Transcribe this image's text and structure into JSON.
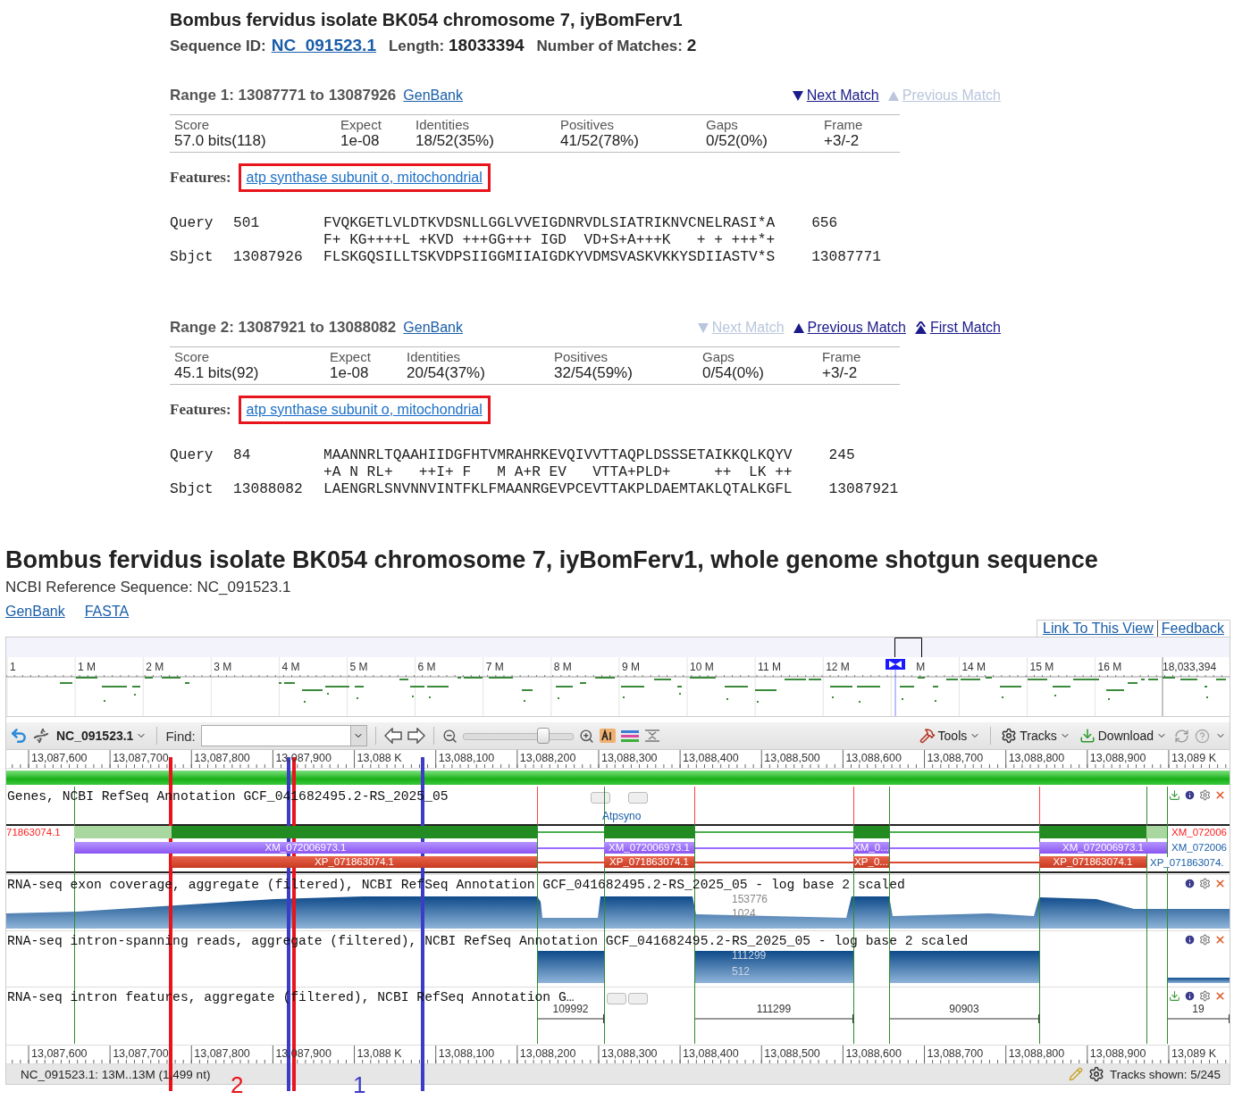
{
  "blast": {
    "title": "Bombus fervidus isolate BK054 chromosome 7, iyBomFerv1",
    "sequence_id_label": "Sequence ID:",
    "sequence_id": "NC_091523.1",
    "length_label": "Length:",
    "length": "18033394",
    "matches_label": "Number of Matches:",
    "matches": "2",
    "ranges": [
      {
        "title": "Range 1: 13087771 to 13087926",
        "genbank": "GenBank",
        "nav": [
          {
            "kind": "next",
            "label": "Next Match",
            "disabled": false
          },
          {
            "kind": "previous",
            "label": "Previous Match",
            "disabled": true
          }
        ],
        "stats": [
          {
            "label": "Score",
            "value": "57.0 bits(118)"
          },
          {
            "label": "Expect",
            "value": "1e-08"
          },
          {
            "label": "Identities",
            "value": "18/52(35%)"
          },
          {
            "label": "Positives",
            "value": "41/52(78%)"
          },
          {
            "label": "Gaps",
            "value": "0/52(0%)"
          },
          {
            "label": "Frame",
            "value": "+3/-2"
          }
        ],
        "features_label": "Features:",
        "feature": "atp synthase subunit o, mitochondrial",
        "query": {
          "label": "Query",
          "start": "501",
          "sequence": "FVQKGETLVLDTKVDSNLLGGLVVEIGDNRVDLSIATRIKNVCNELRASI*A",
          "end": "656"
        },
        "midline": "F+ KG++++L +KVD +++GG+++ IGD  VD+S+A+++K   + + +++*+",
        "subject": {
          "label": "Sbjct",
          "start": "13087926",
          "sequence": "FLSKGQSILLTSKVDPSIIGGMIIAIGDKYVDMSVASKVKKYSDIIASTV*S",
          "end": "13087771"
        }
      },
      {
        "title": "Range 2: 13087921 to 13088082",
        "genbank": "GenBank",
        "nav": [
          {
            "kind": "next",
            "label": "Next Match",
            "disabled": true
          },
          {
            "kind": "previous",
            "label": "Previous Match",
            "disabled": false
          },
          {
            "kind": "first",
            "label": "First Match",
            "disabled": false
          }
        ],
        "stats": [
          {
            "label": "Score",
            "value": "45.1 bits(92)"
          },
          {
            "label": "Expect",
            "value": "1e-08"
          },
          {
            "label": "Identities",
            "value": "20/54(37%)"
          },
          {
            "label": "Positives",
            "value": "32/54(59%)"
          },
          {
            "label": "Gaps",
            "value": "0/54(0%)"
          },
          {
            "label": "Frame",
            "value": "+3/-2"
          }
        ],
        "features_label": "Features:",
        "feature": "atp synthase subunit o, mitochondrial",
        "query": {
          "label": "Query",
          "start": "84",
          "sequence": "MAANNRLTQAAHIIDGFHTVMRAHRKEVQIVVTTAQPLDSSSETAIKKQLKQYV",
          "end": "245"
        },
        "midline": "+A N RL+   ++I+ F   M A+R EV   VTTA+PLD+     ++  LK ++",
        "subject": {
          "label": "Sbjct",
          "start": "13088082",
          "sequence": "LAENGRLSNVNNVINTFKLFMAANRGEVPCEVTTAKPLDAEMTAKLQTALKGFL",
          "end": "13087921"
        }
      }
    ]
  },
  "page_title": "Bombus fervidus isolate BK054 chromosome 7, iyBomFerv1, whole genome shotgun sequence",
  "refseq": "NCBI Reference Sequence: NC_091523.1",
  "links": [
    "GenBank",
    "FASTA"
  ],
  "viewer": {
    "top_links": [
      "Link To This View",
      "Feedback"
    ],
    "overview_ticks": [
      "1",
      "1 M",
      "2 M",
      "3 M",
      "4 M",
      "5 M",
      "6 M",
      "7 M",
      "8 M",
      "9 M",
      "10 M",
      "11 M",
      "12 M",
      "M",
      "14 M",
      "15 M",
      "16 M",
      "18,033,394"
    ],
    "toolbar": {
      "sequence": "NC_091523.1",
      "find_label": "Find:",
      "zoom": {
        "level": 0.72
      },
      "menus": [
        "Tools",
        "Tracks",
        "Download"
      ]
    },
    "ruler_ticks": [
      "13,087,600",
      "13,087,700",
      "13,087,800",
      "13,087,900",
      "13,088 K",
      "13,088,100",
      "13,088,200",
      "13,088,300",
      "13,088,400",
      "13,088,500",
      "13,088,600",
      "13,088,700",
      "13,088,800",
      "13,088,900",
      "13,089 K"
    ],
    "genes_track": {
      "title": "Genes, NCBI RefSeq Annotation GCF_041682495.2-RS_2025_05",
      "gene": "Atpsyno",
      "left_label": "71863074.1",
      "rows": [
        {
          "kind": "gene",
          "labels": []
        },
        {
          "kind": "mrna",
          "labels": [
            "XM_072006973.1",
            "XM_072006973.1",
            "XM_0...",
            "XM_072006973.1"
          ]
        },
        {
          "kind": "cds",
          "labels": [
            "XP_071863074.1",
            "XP_071863074.1",
            "XP_0...",
            "XP_071863074.1"
          ]
        }
      ],
      "right_labels": [
        {
          "text": "XM_072006",
          "highlighted": true
        },
        {
          "text": "XM_072006",
          "highlighted": false
        },
        {
          "text": "XP_071863074.",
          "highlighted": false
        }
      ]
    },
    "coverage_track": {
      "title": "RNA-seq exon coverage, aggregate (filtered), NCBI RefSeq Annotation GCF_041682495.2-RS_2025_05 - log base 2 scaled",
      "scale": [
        "153776",
        "1024"
      ]
    },
    "intron_reads_track": {
      "title": "RNA-seq intron-spanning reads, aggregate (filtered), NCBI RefSeq Annotation GCF_041682495.2-RS_2025_05 - log base 2 scaled",
      "scale": [
        "111299",
        "512"
      ]
    },
    "intron_features_track": {
      "title": "RNA-seq intron features, aggregate (filtered), NCBI RefSeq Annotation G…",
      "introns": [
        "109992",
        "111299",
        "90903",
        "19"
      ]
    },
    "bottom_ruler_ticks": [
      "13,087,600",
      "13,087,700",
      "13,087,800",
      "13,087,900",
      "13,088 K",
      "13,088,100",
      "13,088,200",
      "13,088,300",
      "13,088,400",
      "13,088,500",
      "13,088,600",
      "13,088,700",
      "13,088,800",
      "13,088,900",
      "13,089 K"
    ],
    "status": {
      "location": "NC_091523.1: 13M..13M (1,499 nt)",
      "tracks": "Tracks shown: 5/245"
    }
  },
  "annotations": [
    {
      "label": "2",
      "color": "#e8141c"
    },
    {
      "label": "1",
      "color": "#3c3cc8"
    }
  ]
}
